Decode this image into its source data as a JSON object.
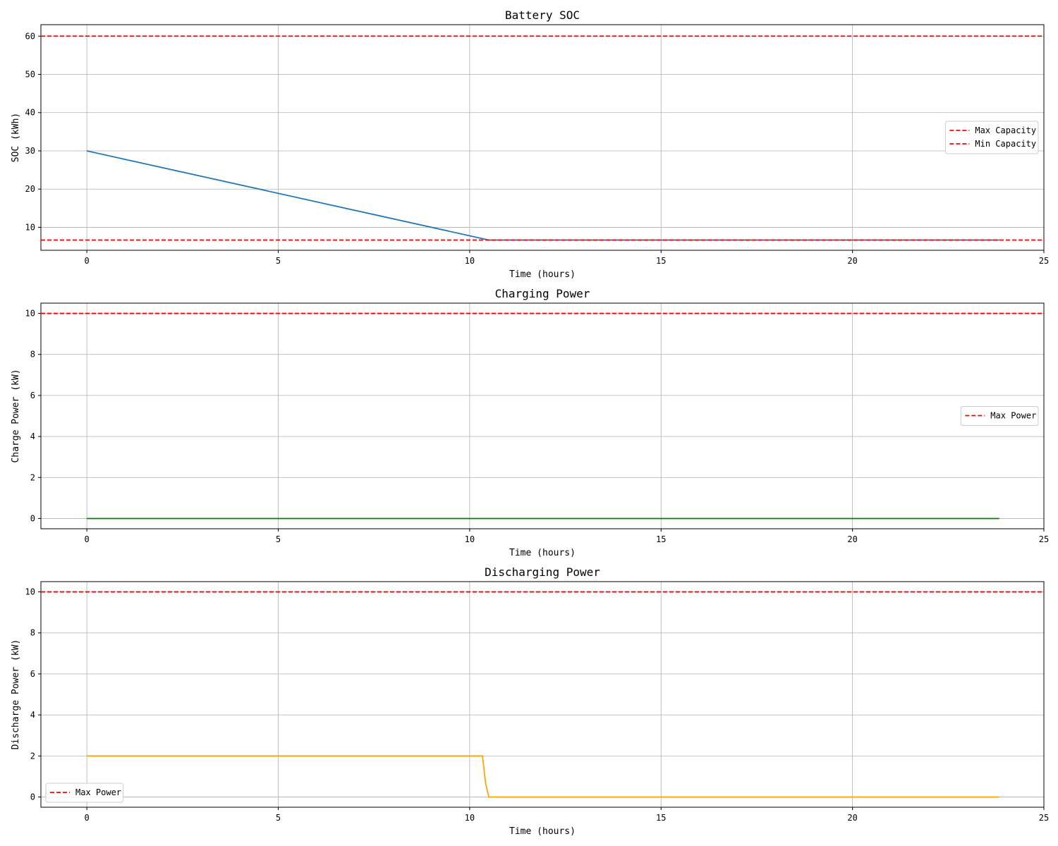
{
  "chart_data": [
    {
      "type": "line",
      "title": "Battery SOC",
      "xlabel": "Time (hours)",
      "ylabel": "SOC (kWh)",
      "xlim": [
        -1.2,
        25
      ],
      "ylim": [
        4,
        63
      ],
      "xticks": [
        0,
        5,
        10,
        15,
        20,
        25
      ],
      "yticks": [
        10,
        20,
        30,
        40,
        50,
        60
      ],
      "grid": true,
      "legend_position": "center-right",
      "series": [
        {
          "name": "",
          "color": "#1f77b4",
          "style": "solid",
          "x": [
            0,
            10.5,
            23.833
          ],
          "y": [
            30,
            6.67,
            6.67
          ]
        }
      ],
      "hlines": [
        {
          "name": "Max Capacity",
          "y": 60,
          "color": "#ff0000",
          "style": "dashed"
        },
        {
          "name": "Min Capacity",
          "y": 6.67,
          "color": "#ff0000",
          "style": "dashed"
        }
      ]
    },
    {
      "type": "line",
      "title": "Charging Power",
      "xlabel": "Time (hours)",
      "ylabel": "Charge Power (kW)",
      "xlim": [
        -1.2,
        25
      ],
      "ylim": [
        -0.5,
        10.5
      ],
      "xticks": [
        0,
        5,
        10,
        15,
        20,
        25
      ],
      "yticks": [
        0,
        2,
        4,
        6,
        8,
        10
      ],
      "grid": true,
      "legend_position": "center-right",
      "series": [
        {
          "name": "",
          "color": "#008000",
          "style": "solid",
          "x": [
            0,
            23.833
          ],
          "y": [
            0,
            0
          ]
        }
      ],
      "hlines": [
        {
          "name": "Max Power",
          "y": 10,
          "color": "#ff0000",
          "style": "dashed"
        }
      ]
    },
    {
      "type": "line",
      "title": "Discharging Power",
      "xlabel": "Time (hours)",
      "ylabel": "Discharge Power (kW)",
      "xlim": [
        -1.2,
        25
      ],
      "ylim": [
        -0.5,
        10.5
      ],
      "xticks": [
        0,
        5,
        10,
        15,
        20,
        25
      ],
      "yticks": [
        0,
        2,
        4,
        6,
        8,
        10
      ],
      "grid": true,
      "legend_position": "lower-left",
      "series": [
        {
          "name": "",
          "color": "#ffa500",
          "style": "solid",
          "x": [
            0,
            10.333,
            10.417,
            10.5,
            23.833
          ],
          "y": [
            2,
            2,
            0.67,
            0,
            0
          ]
        }
      ],
      "hlines": [
        {
          "name": "Max Power",
          "y": 10,
          "color": "#ff0000",
          "style": "dashed"
        }
      ]
    }
  ]
}
